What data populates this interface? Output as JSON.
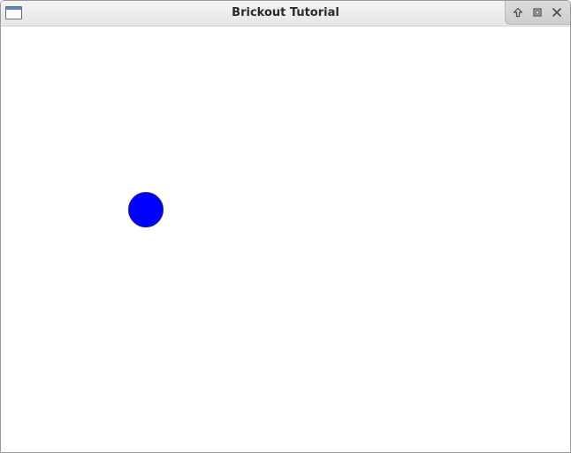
{
  "window": {
    "title": "Brickout Tutorial"
  },
  "titlebar": {
    "icons": {
      "app": "window-icon",
      "shade": "arrow-up-icon",
      "maximize": "maximize-icon",
      "close": "close-icon"
    }
  },
  "game": {
    "ball": {
      "color": "#0000ff"
    },
    "background_color": "#ffffff"
  }
}
